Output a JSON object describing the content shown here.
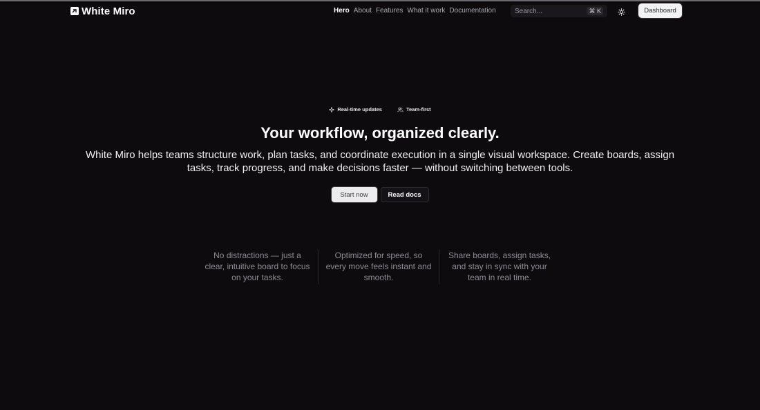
{
  "brand": {
    "name": "White Miro"
  },
  "nav": {
    "links": [
      {
        "label": "Hero",
        "active": true
      },
      {
        "label": "About",
        "active": false
      },
      {
        "label": "Features",
        "active": false
      },
      {
        "label": "What it work",
        "active": false
      },
      {
        "label": "Documentation",
        "active": false
      }
    ],
    "search": {
      "placeholder": "Search...",
      "shortcut": "⌘ K"
    },
    "theme_icon": "sun-icon",
    "dashboard_label": "Dashboard"
  },
  "hero": {
    "badges": [
      {
        "icon": "sparkle-icon",
        "label": "Real-time updates"
      },
      {
        "icon": "users-icon",
        "label": "Team-first"
      }
    ],
    "title": "Your workflow, organized clearly.",
    "description": "White Miro helps teams structure work, plan tasks, and coordinate execution in a single visual workspace. Create boards, assign tasks, track progress, and make decisions faster — without switching between tools.",
    "primary_cta": "Start now",
    "secondary_cta": "Read docs"
  },
  "features": [
    {
      "text": "No distractions — just a clear, intuitive board to focus on your tasks."
    },
    {
      "text": "Optimized for speed, so every move feels instant and smooth."
    },
    {
      "text": "Share boards, assign tasks, and stay in sync with your team in real time."
    }
  ],
  "colors": {
    "background": "#0d0b0e",
    "text": "#ffffff",
    "muted": "#8e8d93"
  }
}
